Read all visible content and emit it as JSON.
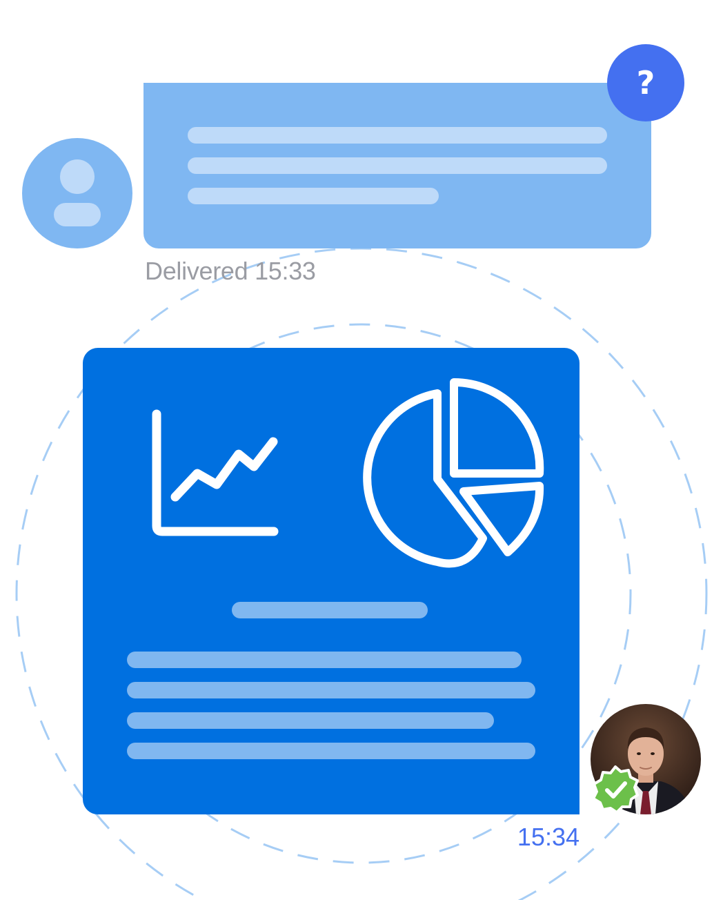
{
  "incoming_message": {
    "status_text": "Delivered 15:33",
    "badge_symbol": "?",
    "badge_icon": "question-mark-icon",
    "avatar_icon": "user-placeholder-icon"
  },
  "outgoing_message": {
    "time_text": "15:34",
    "attachment_icons": [
      "line-chart-icon",
      "pie-chart-icon"
    ],
    "sender_avatar": "person-photo-avatar",
    "verified_icon": "check-badge-icon"
  },
  "colors": {
    "incoming_bubble": "#7FB7F2",
    "outgoing_bubble": "#0070E0",
    "accent": "#4470F0",
    "status_gray": "#9A9CA3",
    "verified_green": "#6CC04A",
    "ring_dashes": "#A6CDF5"
  }
}
